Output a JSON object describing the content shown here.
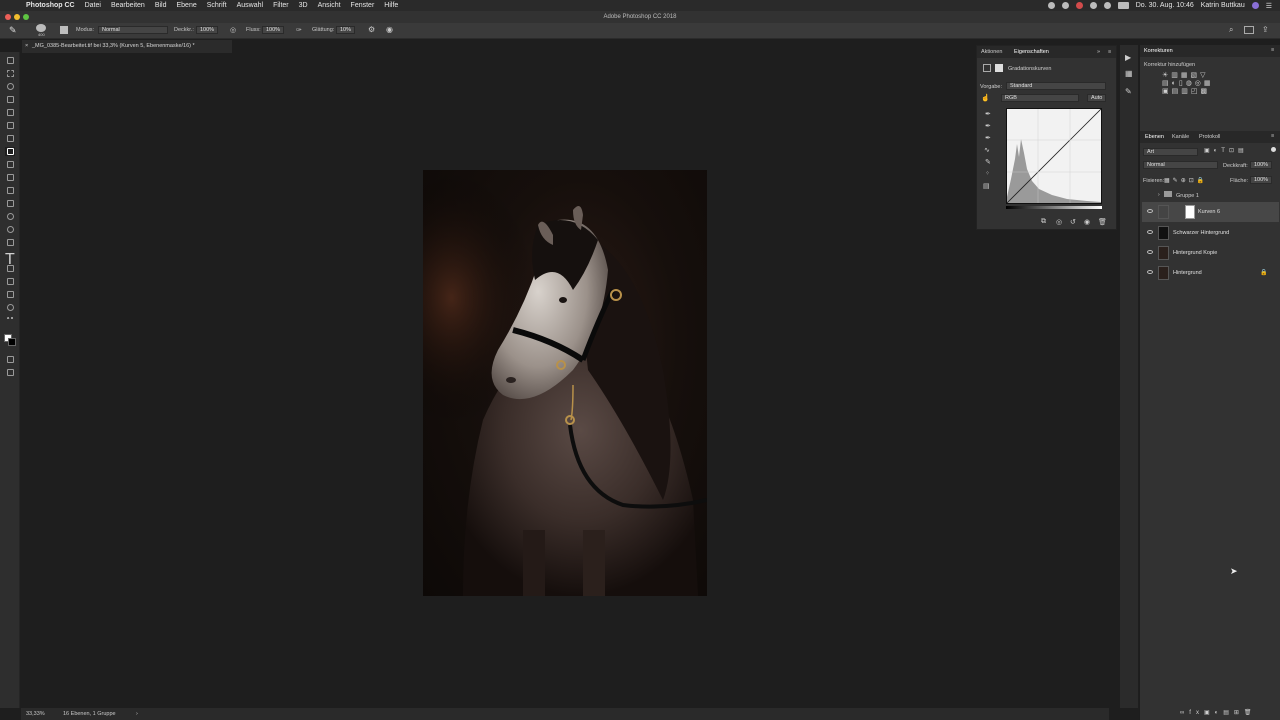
{
  "menubar": {
    "apple_glyph": "",
    "items": [
      "Photoshop CC",
      "Datei",
      "Bearbeiten",
      "Bild",
      "Ebene",
      "Schrift",
      "Auswahl",
      "Filter",
      "3D",
      "Ansicht",
      "Fenster",
      "Hilfe"
    ],
    "datetime": "Do. 30. Aug. 10:46",
    "user": "Katrin Buttkau"
  },
  "titlebar": {
    "title": "Adobe Photoshop CC 2018"
  },
  "options": {
    "brush_size": "400",
    "mode_label": "Modus:",
    "mode_value": "Normal",
    "opacity_label": "Deckkr.:",
    "opacity_value": "100%",
    "flow_label": "Fluss:",
    "flow_value": "100%",
    "smoothing_label": "Glättung:",
    "smoothing_value": "10%"
  },
  "document": {
    "tab_title": "_MG_0385-Bearbeitet.tif bei 33,3% (Kurven 5, Ebenenmaske/16) *"
  },
  "status": {
    "zoom": "33,33%",
    "info": "16 Ebenen, 1 Gruppe",
    "arrow": "›"
  },
  "properties": {
    "tabs": [
      "Aktionen",
      "Eigenschaften"
    ],
    "adjustment_title": "Gradationskurven",
    "preset_label": "Vorgabe:",
    "preset_value": "Standard",
    "channel_value": "RGB",
    "auto_label": "Auto"
  },
  "corrections": {
    "title": "Korrekturen",
    "subtitle": "Korrektur hinzufügen"
  },
  "layers_panel": {
    "tabs": [
      "Ebenen",
      "Kanäle",
      "Protokoll"
    ],
    "filter_label": "Art",
    "blend_mode": "Normal",
    "opacity_label": "Deckkraft:",
    "opacity_value": "100%",
    "lock_label": "Fixieren:",
    "fill_label": "Fläche:",
    "fill_value": "100%",
    "group_name": "Gruppe 1",
    "layers": [
      {
        "name": "Kurven 6",
        "selected": true
      },
      {
        "name": "Schwarzer Hintergrund",
        "selected": false
      },
      {
        "name": "Hintergrund Kopie",
        "selected": false
      },
      {
        "name": "Hintergrund",
        "selected": false,
        "locked": true
      }
    ]
  },
  "colors": {
    "accent": "#e6e6e6",
    "panel": "#323232",
    "canvas": "#1e1e1e"
  }
}
